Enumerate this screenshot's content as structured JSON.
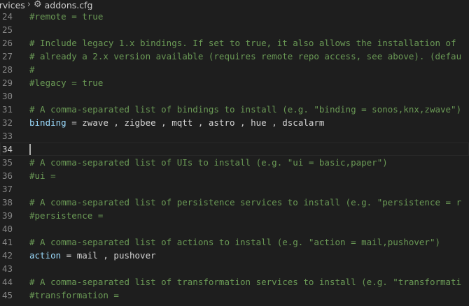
{
  "breadcrumb": {
    "folder": "ervices",
    "separator": "›",
    "file_icon": "gear-icon",
    "file_name": "addons.cfg"
  },
  "editor": {
    "cursor_line": 34,
    "lines": [
      {
        "number": "24",
        "kind": "comment",
        "text": "#remote = true"
      },
      {
        "number": "25",
        "kind": "blank",
        "text": ""
      },
      {
        "number": "26",
        "kind": "comment",
        "text": "# Include legacy 1.x bindings. If set to true, it also allows the installation of"
      },
      {
        "number": "27",
        "kind": "comment",
        "text": "# already a 2.x version available (requires remote repo access, see above). (defau"
      },
      {
        "number": "28",
        "kind": "comment",
        "text": "#"
      },
      {
        "number": "29",
        "kind": "comment",
        "text": "#legacy = true"
      },
      {
        "number": "30",
        "kind": "blank",
        "text": ""
      },
      {
        "number": "31",
        "kind": "comment",
        "text": "# A comma-separated list of bindings to install (e.g. \"binding = sonos,knx,zwave\")"
      },
      {
        "number": "32",
        "kind": "setting",
        "key": "binding",
        "operator": " = ",
        "value": "zwave , zigbee , mqtt , astro , hue , dscalarm"
      },
      {
        "number": "33",
        "kind": "blank",
        "text": ""
      },
      {
        "number": "34",
        "kind": "blank",
        "text": ""
      },
      {
        "number": "35",
        "kind": "comment",
        "text": "# A comma-separated list of UIs to install (e.g. \"ui = basic,paper\")"
      },
      {
        "number": "36",
        "kind": "comment",
        "text": "#ui ="
      },
      {
        "number": "37",
        "kind": "blank",
        "text": ""
      },
      {
        "number": "38",
        "kind": "comment",
        "text": "# A comma-separated list of persistence services to install (e.g. \"persistence = r"
      },
      {
        "number": "39",
        "kind": "comment",
        "text": "#persistence ="
      },
      {
        "number": "40",
        "kind": "blank",
        "text": ""
      },
      {
        "number": "41",
        "kind": "comment",
        "text": "# A comma-separated list of actions to install (e.g. \"action = mail,pushover\")"
      },
      {
        "number": "42",
        "kind": "setting",
        "key": "action",
        "operator": " = ",
        "value": "mail , pushover"
      },
      {
        "number": "43",
        "kind": "blank",
        "text": ""
      },
      {
        "number": "44",
        "kind": "comment",
        "text": "# A comma-separated list of transformation services to install (e.g. \"transformati"
      },
      {
        "number": "45",
        "kind": "comment",
        "text": "#transformation ="
      }
    ]
  },
  "colors": {
    "background": "#1e1e1e",
    "comment": "#6a9955",
    "key": "#9cdcfe",
    "text": "#d4d4d4",
    "line_number": "#858585"
  }
}
